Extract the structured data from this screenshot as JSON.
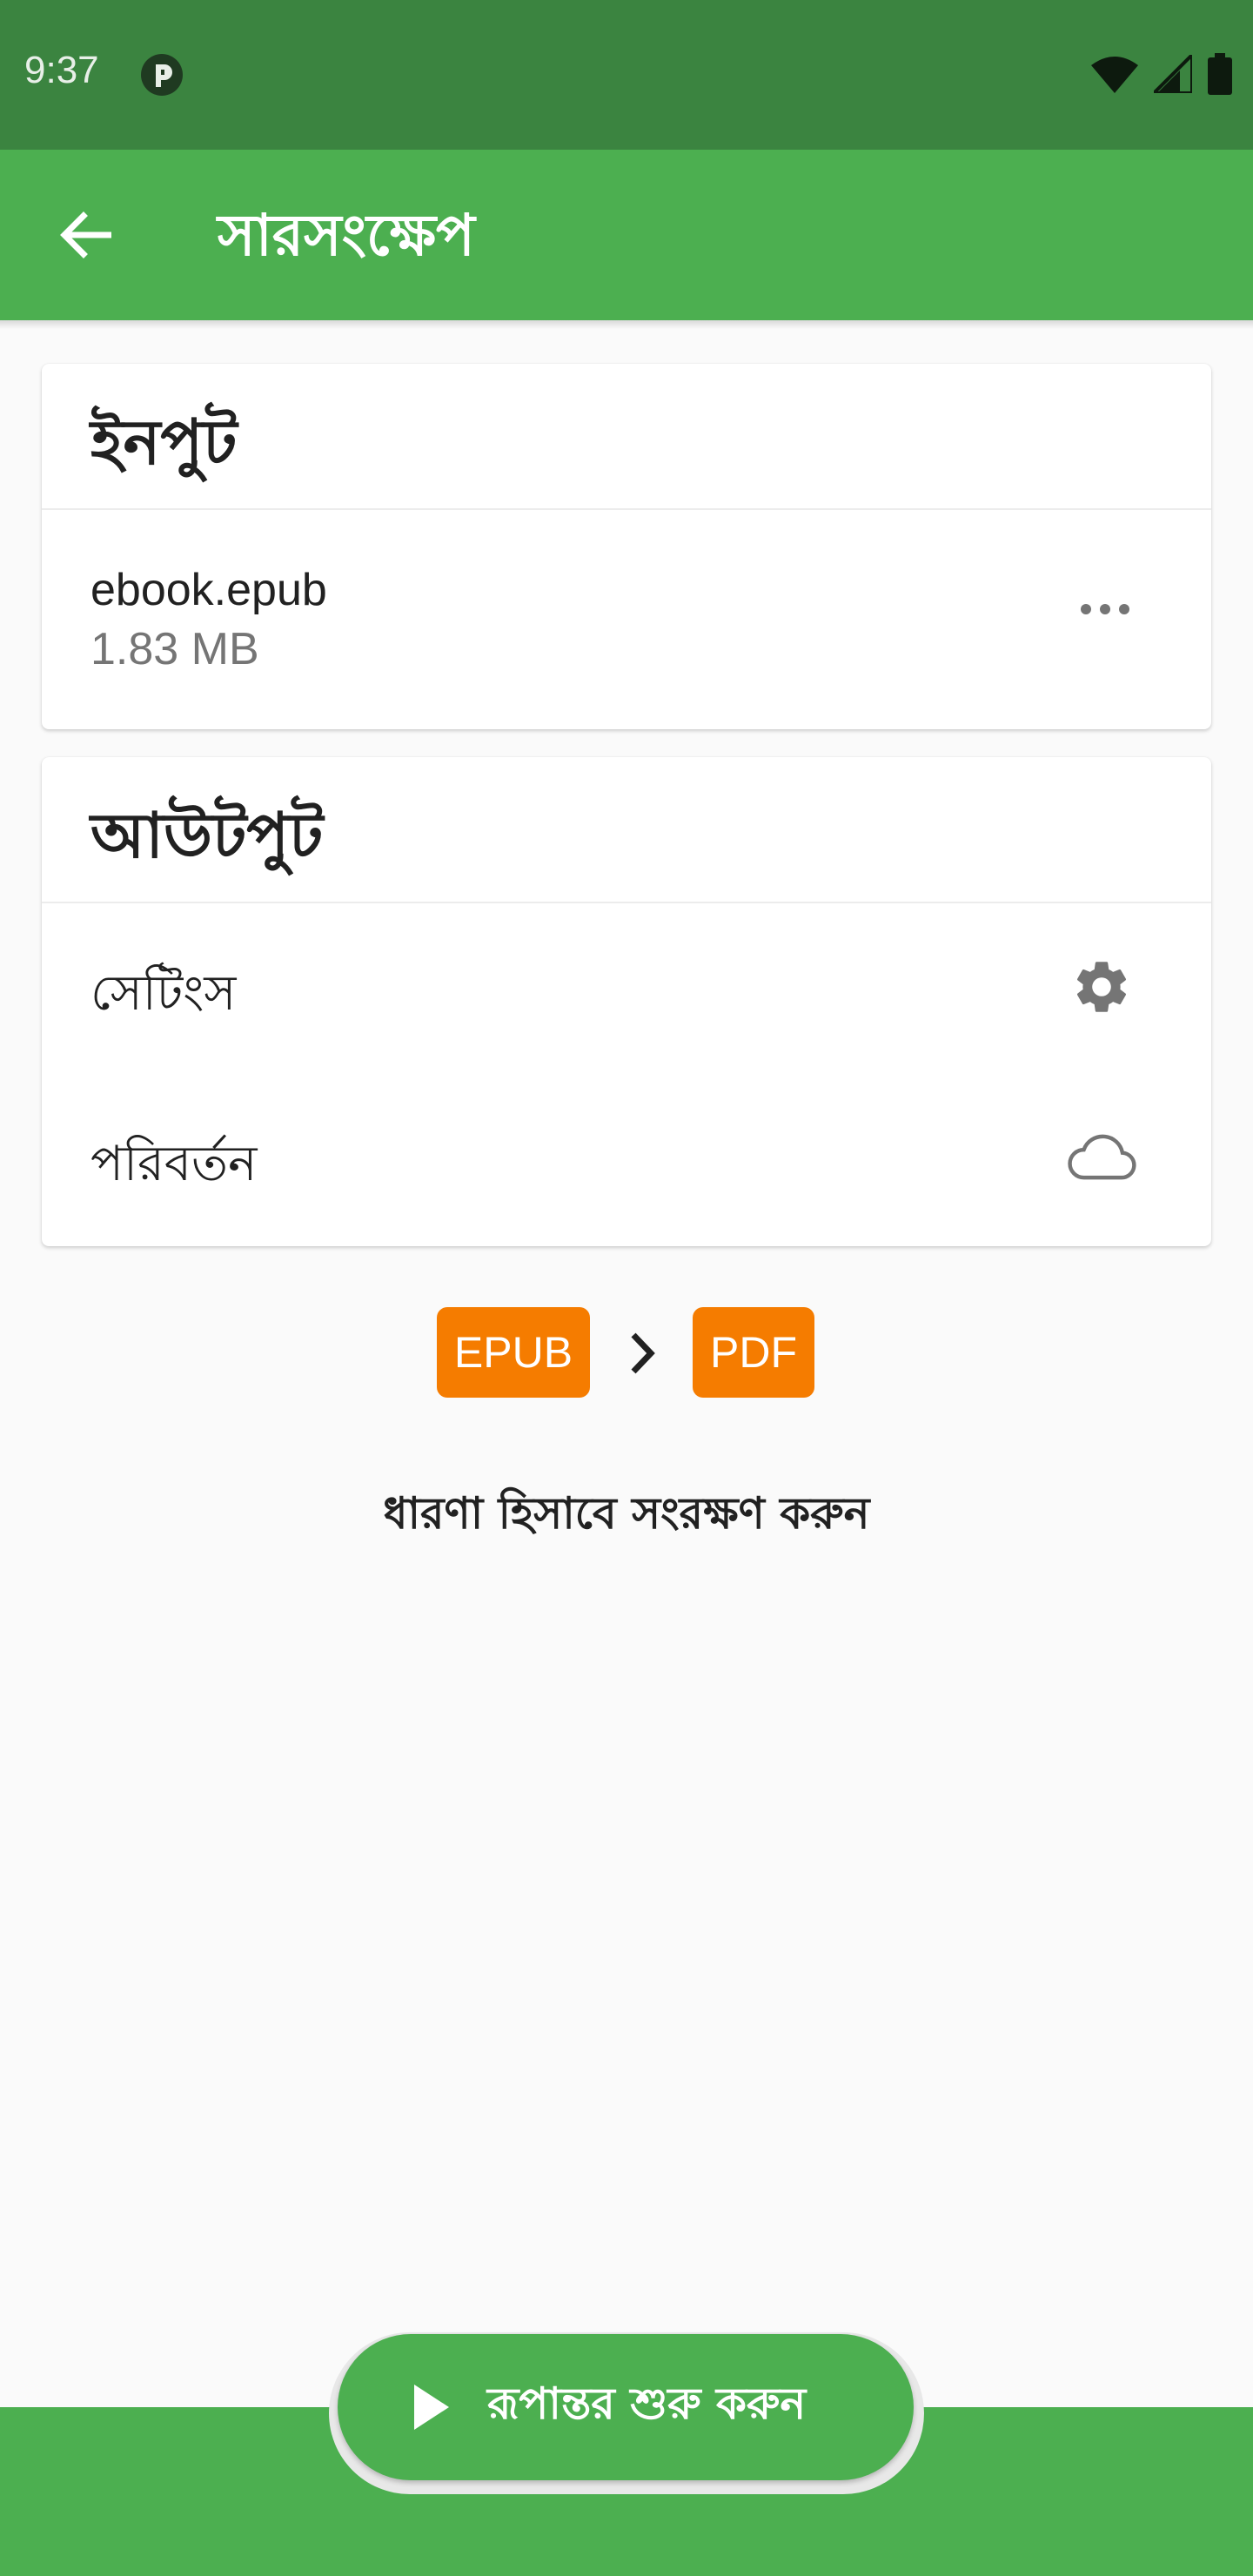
{
  "status_bar": {
    "time": "9:37"
  },
  "toolbar": {
    "title": "সারসংক্ষেপ",
    "back_icon": "arrow-left-icon"
  },
  "input_card": {
    "title": "ইনপুট",
    "file": {
      "name": "ebook.epub",
      "size": "1.83 MB"
    }
  },
  "output_card": {
    "title": "আউটপুট",
    "settings_label": "সেটিংস",
    "convert_label": "পরিবর্তন"
  },
  "formats": {
    "from": "EPUB",
    "to": "PDF"
  },
  "save_concept_label": "ধারণা হিসাবে সংরক্ষণ করুন",
  "start_button": {
    "label": "রূপান্তর শুরু করুন"
  },
  "colors": {
    "status_bar": "#3b8440",
    "toolbar": "#4caf50",
    "chip": "#f57c00"
  }
}
